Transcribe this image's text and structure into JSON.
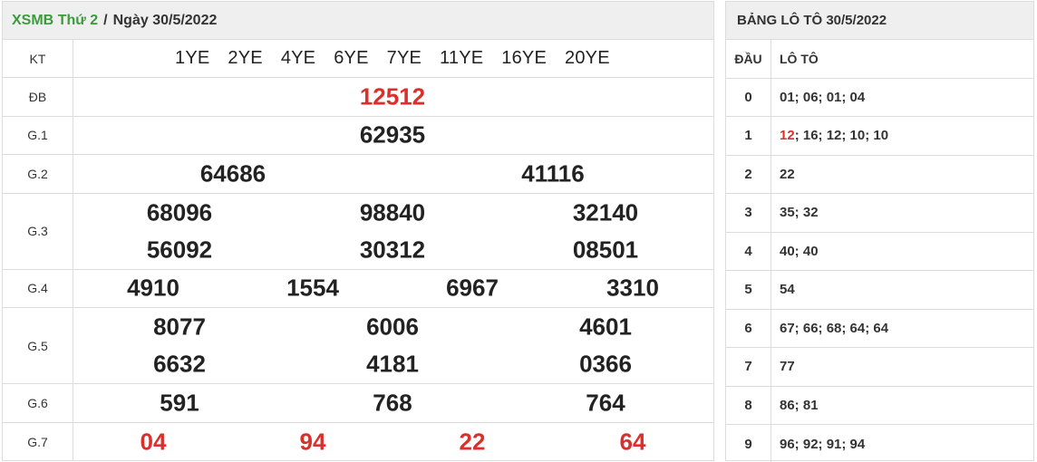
{
  "results": {
    "header": {
      "site": "XSMB",
      "weekday": "Thứ 2",
      "separator": "/",
      "date": "Ngày 30/5/2022"
    },
    "kt_label": "KT",
    "codes": [
      "1YE",
      "2YE",
      "4YE",
      "6YE",
      "7YE",
      "11YE",
      "16YE",
      "20YE"
    ],
    "prizes": [
      {
        "label": "ĐB",
        "numbers": [
          "12512"
        ]
      },
      {
        "label": "G.1",
        "numbers": [
          "62935"
        ]
      },
      {
        "label": "G.2",
        "numbers": [
          "64686",
          "41116"
        ]
      },
      {
        "label": "G.3",
        "numbers": [
          "68096",
          "98840",
          "32140",
          "56092",
          "30312",
          "08501"
        ]
      },
      {
        "label": "G.4",
        "numbers": [
          "4910",
          "1554",
          "6967",
          "3310"
        ]
      },
      {
        "label": "G.5",
        "numbers": [
          "8077",
          "6006",
          "4601",
          "6632",
          "4181",
          "0366"
        ]
      },
      {
        "label": "G.6",
        "numbers": [
          "591",
          "768",
          "764"
        ]
      },
      {
        "label": "G.7",
        "numbers": [
          "04",
          "94",
          "22",
          "64"
        ]
      }
    ]
  },
  "loto": {
    "title": "BẢNG LÔ TÔ 30/5/2022",
    "head_label": "ĐẦU",
    "loto_label": "LÔ TÔ",
    "rows": [
      {
        "head": "0",
        "values": "01; 06; 01; 04"
      },
      {
        "head": "1",
        "first": "12",
        "values": "; 16; 12; 10; 10"
      },
      {
        "head": "2",
        "values": "22"
      },
      {
        "head": "3",
        "values": "35; 32"
      },
      {
        "head": "4",
        "values": "40; 40"
      },
      {
        "head": "5",
        "values": "54"
      },
      {
        "head": "6",
        "values": "67; 66; 68; 64; 64"
      },
      {
        "head": "7",
        "values": "77"
      },
      {
        "head": "8",
        "values": "86; 81"
      },
      {
        "head": "9",
        "values": "96; 92; 91; 94"
      }
    ]
  },
  "colors": {
    "accent_green": "#3d9a3d",
    "highlight_red": "#d9302c",
    "header_bg": "#efefef",
    "border": "#dcdcdc"
  }
}
